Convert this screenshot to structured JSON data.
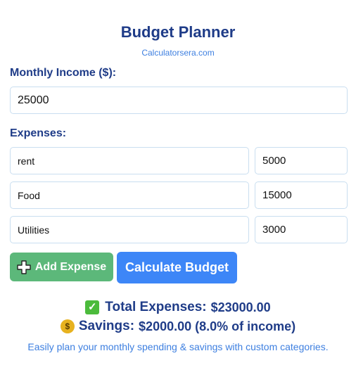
{
  "header": {
    "title": "Budget Planner",
    "subtitle": "Calculatorsera.com"
  },
  "income": {
    "label": "Monthly Income ($):",
    "value": "25000"
  },
  "expenses": {
    "label": "Expenses:",
    "items": [
      {
        "name": "rent",
        "amount": "5000"
      },
      {
        "name": "Food",
        "amount": "15000"
      },
      {
        "name": "Utilities",
        "amount": "3000"
      }
    ]
  },
  "buttons": {
    "add_label": "Add Expense",
    "calculate_label": "Calculate Budget"
  },
  "results": {
    "total_label": "Total Expenses:",
    "total_value": "$23000.00",
    "savings_label": "Savings:",
    "savings_value": "$2000.00 (8.0% of income)"
  },
  "footer": {
    "text": "Easily plan your monthly spending & savings with custom categories."
  },
  "colors": {
    "heading": "#1f3c88",
    "link": "#3d7fe0",
    "add_button": "#5cb87a",
    "calculate_button": "#3d86f7",
    "input_border": "#c9def0"
  },
  "icons": {
    "add": "plus-icon",
    "total": "check-mark-icon",
    "savings": "money-bag-icon"
  }
}
